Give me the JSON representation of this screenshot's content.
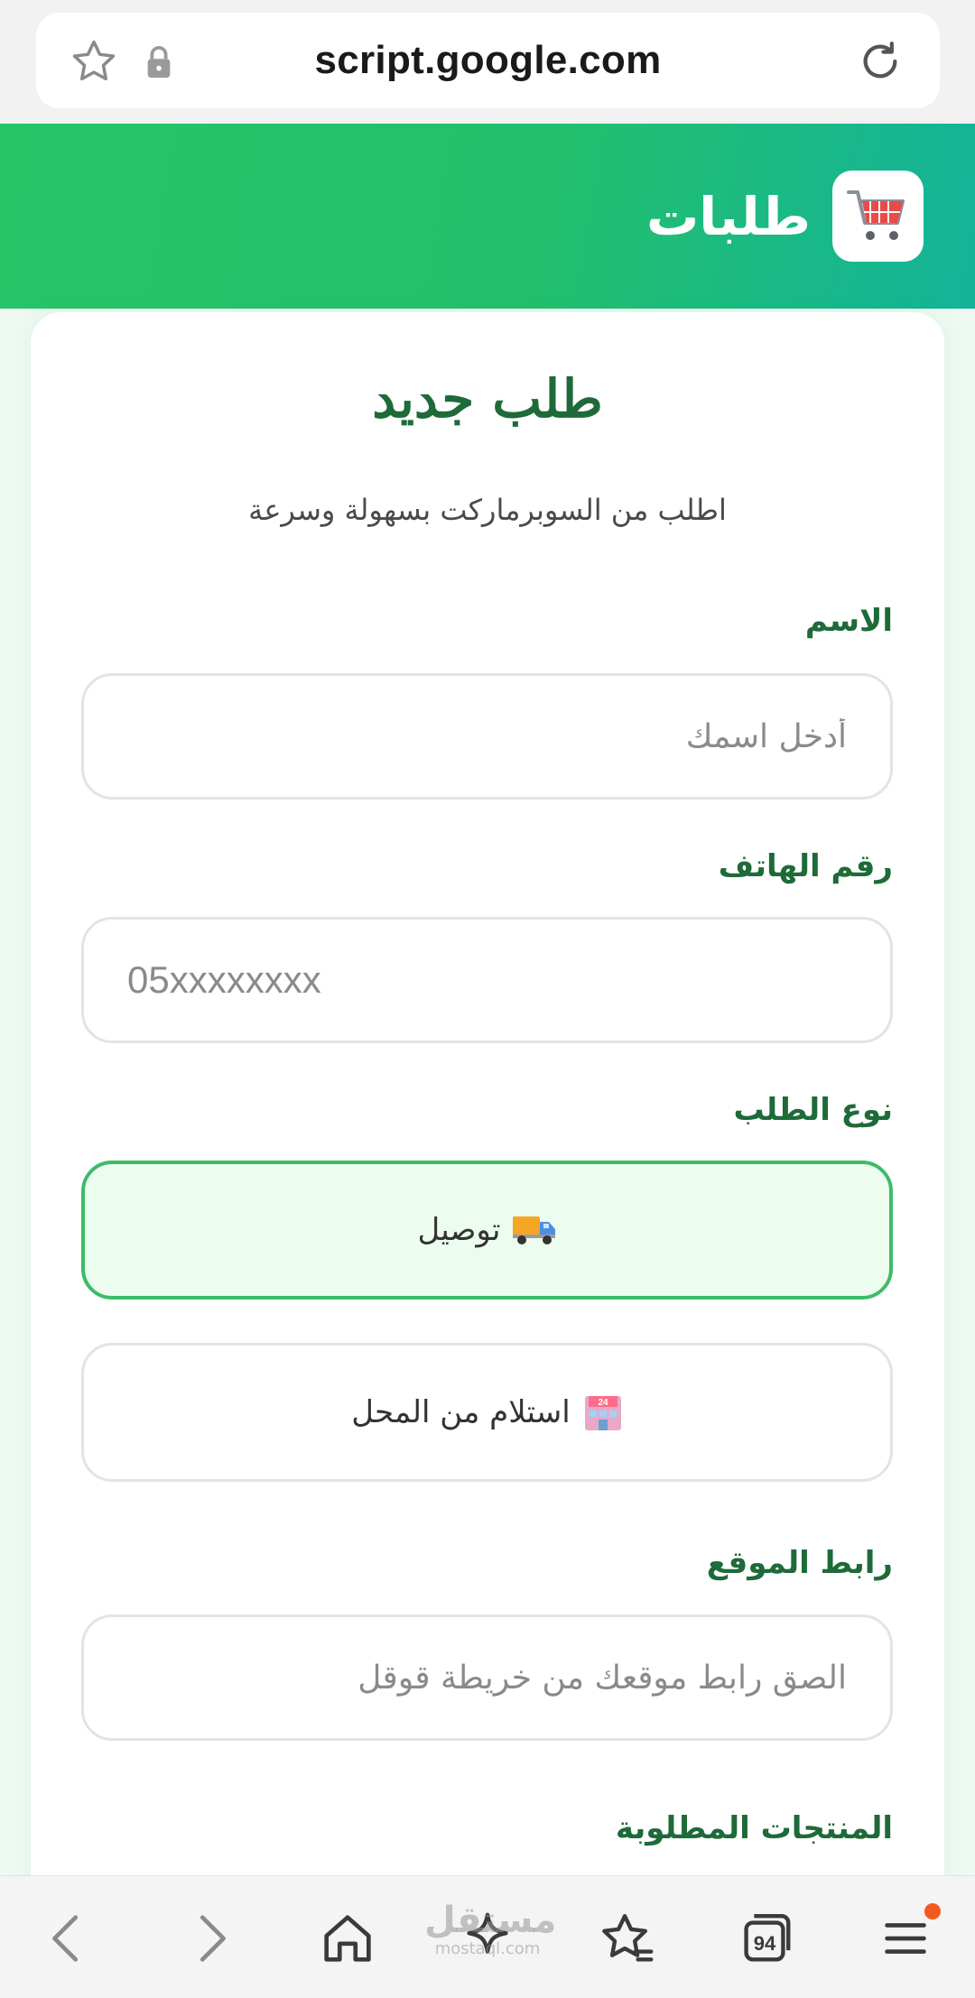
{
  "browser": {
    "url": "script.google.com",
    "tab_count": "94"
  },
  "header": {
    "title": "طلبات"
  },
  "form": {
    "title": "طلب جديد",
    "subtitle": "اطلب من السوبرماركت بسهولة وسرعة",
    "name_label": "الاسم",
    "name_placeholder": "أدخل اسمك",
    "phone_label": "رقم الهاتف",
    "phone_placeholder": "05xxxxxxxx",
    "order_type_label": "نوع الطلب",
    "order_types": [
      {
        "label": "توصيل",
        "icon": "delivery-truck-icon",
        "selected": true
      },
      {
        "label": "استلام من المحل",
        "icon": "store-icon",
        "selected": false
      }
    ],
    "location_label": "رابط الموقع",
    "location_placeholder": "الصق رابط موقعك من خريطة قوقل",
    "products_label": "المنتجات المطلوبة"
  },
  "watermark": {
    "main": "مستقل",
    "sub": "mostaql.com"
  },
  "colors": {
    "accent_green": "#1e6a39",
    "header_start": "#27c468",
    "header_end": "#14b39a",
    "selected_border": "#3cbc6a",
    "notification": "#f25a22"
  }
}
